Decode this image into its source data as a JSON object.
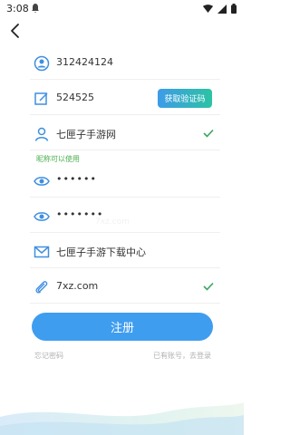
{
  "status_bar": {
    "time": "3:08"
  },
  "form": {
    "account": "312424124",
    "code": "524525",
    "get_code_label": "获取验证码",
    "nickname": "七匣子手游网",
    "nickname_hint": "昵称可以使用",
    "password": "••••••",
    "confirm_password": "•••••••",
    "email": "七匣子手游下载中心",
    "website": "7xz.com"
  },
  "watermark": "7xz.com",
  "register_label": "注册",
  "forgot_password_label": "忘记密码",
  "login_link_label": "已有账号，去登录",
  "colors": {
    "accent": "#3f9df0",
    "success": "#4caf50",
    "gradient_end": "#2cc3a3"
  }
}
